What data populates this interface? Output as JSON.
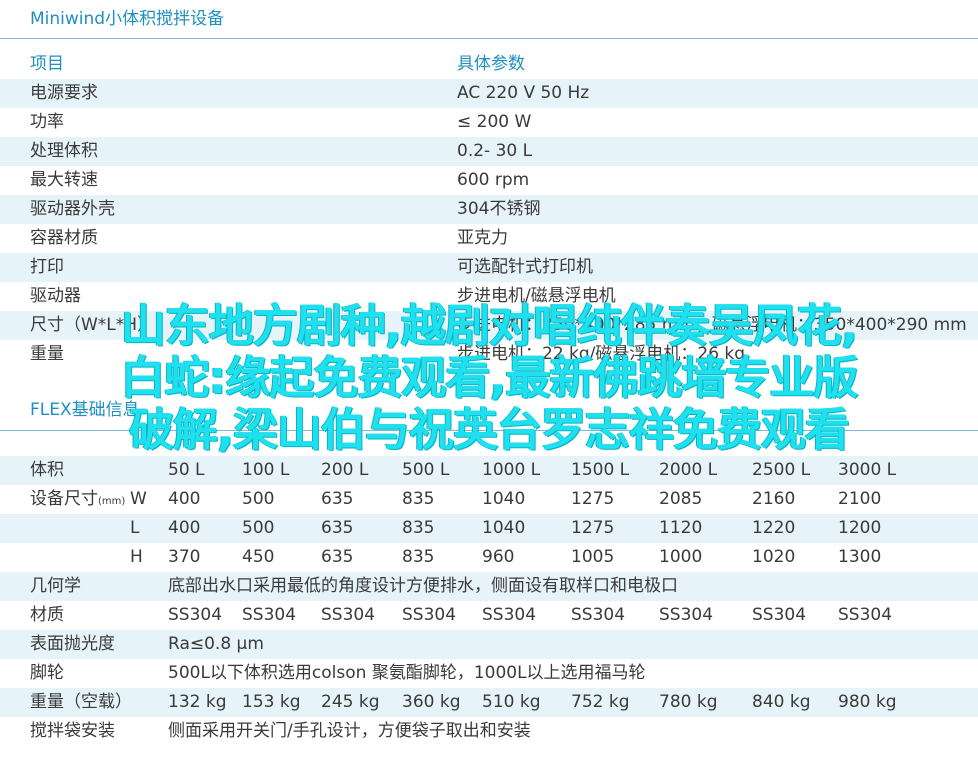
{
  "title": "Miniwind小体积搅拌设备",
  "specs": {
    "header": [
      "项目",
      "具体参数"
    ],
    "rows": [
      [
        "电源要求",
        "AC 220 V 50 Hz"
      ],
      [
        "功率",
        "≤ 200 W"
      ],
      [
        "处理体积",
        "0.2- 30 L"
      ],
      [
        "最大转速",
        "600 rpm"
      ],
      [
        "驱动器外壳",
        "304不锈钢"
      ],
      [
        "容器材质",
        "亚克力"
      ],
      [
        "打印",
        "可选配针式打印机"
      ],
      [
        "驱动器",
        "步进电机/磁悬浮电机"
      ],
      [
        "尺寸（W*L*H）",
        "步进电机：350*400*285 mm；磁悬浮电机：350*400*290 mm"
      ],
      [
        "重量",
        "步进电机：22 kg/磁悬浮电机：26 kg"
      ]
    ]
  },
  "flex_title": "FLEX基础信息",
  "flex": {
    "volume_label": "体积",
    "volumes": [
      "50 L",
      "100 L",
      "200 L",
      "500 L",
      "1000 L",
      "1500 L",
      "2000 L",
      "2500 L",
      "3000 L"
    ],
    "size_label": "设备尺寸",
    "size_unit": "(mm)",
    "dims": [
      {
        "axis": "W",
        "values": [
          "400",
          "500",
          "635",
          "835",
          "1040",
          "1275",
          "2085",
          "2160",
          "2100"
        ]
      },
      {
        "axis": "L",
        "values": [
          "400",
          "500",
          "635",
          "835",
          "1040",
          "1275",
          "1120",
          "1220",
          "1200"
        ]
      },
      {
        "axis": "H",
        "values": [
          "370",
          "450",
          "635",
          "835",
          "960",
          "1005",
          "1000",
          "1020",
          "1300"
        ]
      }
    ],
    "geometry_label": "几何学",
    "geometry_value": "底部出水口采用最低的角度设计方便排水，侧面设有取样口和电极口",
    "material_label": "材质",
    "materials": [
      "SS304",
      "SS304",
      "SS304",
      "SS304",
      "SS304",
      "SS304",
      "SS304",
      "SS304",
      "SS304"
    ],
    "polish_label": "表面抛光度",
    "polish_value": "Ra≤0.8 μm",
    "caster_label": "脚轮",
    "caster_value": "500L以下体积选用colson 聚氨酯脚轮，1000L以上选用福马轮",
    "weight_label": "重量（空载）",
    "weights": [
      "132 kg",
      "153 kg",
      "245 kg",
      "360 kg",
      "510 kg",
      "752 kg",
      "780 kg",
      "840 kg",
      "980 kg"
    ],
    "bag_label": "搅拌袋安装",
    "bag_value": "侧面采用开关门/手孔设计，方便袋子取出和安装"
  },
  "overlay": {
    "line1": "山东地方剧种,越剧对唱纯伴奏吴凤花,",
    "line2": "白蛇:缘起免费观看,最新佛跳墙专业版",
    "line3": "破解,梁山伯与祝英台罗志祥免费观看"
  }
}
